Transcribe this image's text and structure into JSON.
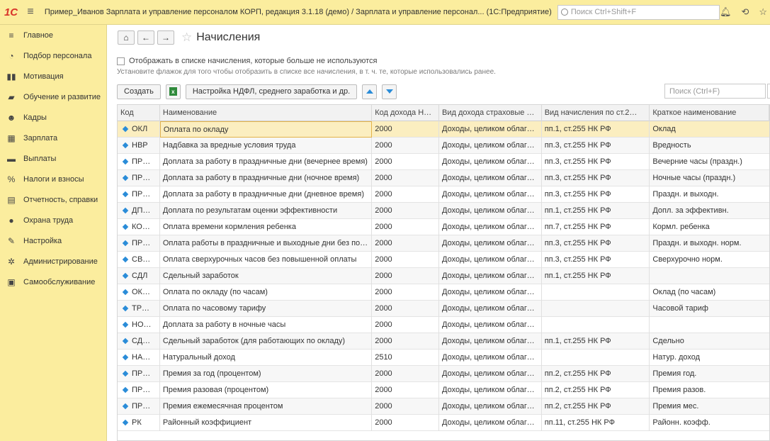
{
  "titlebar": {
    "logo": "1С",
    "title": "Пример_Иванов Зарплата и управление персоналом КОРП, редакция 3.1.18 (демо) / Зарплата и управление персонал...  (1С:Предприятие)",
    "search_placeholder": "Поиск Ctrl+Shift+F",
    "icons": [
      "bell-icon",
      "history-icon",
      "star-icon"
    ]
  },
  "sidebar": {
    "items": [
      {
        "label": "Главное",
        "icon": "≡"
      },
      {
        "label": "Подбор персонала",
        "icon": "◔"
      },
      {
        "label": "Мотивация",
        "icon": "▮▮"
      },
      {
        "label": "Обучение и развитие",
        "icon": "▰"
      },
      {
        "label": "Кадры",
        "icon": "☻"
      },
      {
        "label": "Зарплата",
        "icon": "▦"
      },
      {
        "label": "Выплаты",
        "icon": "▬"
      },
      {
        "label": "Налоги и взносы",
        "icon": "%"
      },
      {
        "label": "Отчетность, справки",
        "icon": "▤"
      },
      {
        "label": "Охрана труда",
        "icon": "●"
      },
      {
        "label": "Настройка",
        "icon": "✎"
      },
      {
        "label": "Администрирование",
        "icon": "✲"
      },
      {
        "label": "Самообслуживание",
        "icon": "▣"
      }
    ]
  },
  "page": {
    "title": "Начисления",
    "checkbox_label": "Отображать в списке начисления, которые больше не используются",
    "hint": "Установите флажок для того чтобы отобразить в списке все начисления, в т. ч. те, которые использовались ранее.",
    "create_label": "Создать",
    "settings_label": "Настройка НДФЛ, среднего заработка и др.",
    "search_placeholder": "Поиск (Ctrl+F)"
  },
  "table": {
    "headers": [
      "Код",
      "Наименование",
      "Код дохода Н…",
      "Вид дохода страховые в…",
      "Вид начисления по ст.2…",
      "Краткое наименование"
    ],
    "rows": [
      [
        "ОКЛ",
        "Оплата по окладу",
        "2000",
        "Доходы, целиком облага…",
        "пп.1, ст.255 НК РФ",
        "Оклад"
      ],
      [
        "НВР",
        "Надбавка за вредные условия труда",
        "2000",
        "Доходы, целиком облага…",
        "пп.3, ст.255 НК РФ",
        "Вредность"
      ],
      [
        "ПР…",
        "Доплата за работу в праздничные дни (вечернее время)",
        "2000",
        "Доходы, целиком облага…",
        "пп.3, ст.255 НК РФ",
        "Вечерние часы (праздн.)"
      ],
      [
        "ПР…",
        "Доплата за работу в праздничные дни (ночное время)",
        "2000",
        "Доходы, целиком облага…",
        "пп.3, ст.255 НК РФ",
        "Ночные часы (праздн.)"
      ],
      [
        "ПР…",
        "Доплата за работу в праздничные дни (дневное время)",
        "2000",
        "Доходы, целиком облага…",
        "пп.3, ст.255 НК РФ",
        "Праздн. и выходн."
      ],
      [
        "ДП…",
        "Доплата по результатам оценки эффективности",
        "2000",
        "Доходы, целиком облага…",
        "пп.1, ст.255 НК РФ",
        "Допл. за эффективн."
      ],
      [
        "КО…",
        "Оплата времени кормления ребенка",
        "2000",
        "Доходы, целиком облага…",
        "пп.7, ст.255 НК РФ",
        "Кормл. ребенка"
      ],
      [
        "ПР…",
        "Оплата работы в праздничные и выходные дни без по…",
        "2000",
        "Доходы, целиком облага…",
        "пп.3, ст.255 НК РФ",
        "Праздн. и выходн. норм."
      ],
      [
        "СВ…",
        "Оплата сверхурочных часов без повышенной оплаты",
        "2000",
        "Доходы, целиком облага…",
        "пп.3, ст.255 НК РФ",
        "Сверхурочно норм."
      ],
      [
        "СДЛ",
        "Сдельный заработок",
        "2000",
        "Доходы, целиком облага…",
        "пп.1, ст.255 НК РФ",
        ""
      ],
      [
        "ОК…",
        "Оплата по окладу (по часам)",
        "2000",
        "Доходы, целиком облага…",
        "",
        "Оклад (по часам)"
      ],
      [
        "ТР…",
        "Оплата по часовому тарифу",
        "2000",
        "Доходы, целиком облага…",
        "",
        "Часовой тариф"
      ],
      [
        "НО…",
        "Доплата за работу в ночные часы",
        "2000",
        "Доходы, целиком облага…",
        "",
        ""
      ],
      [
        "СД…",
        "Сдельный заработок (для работающих по окладу)",
        "2000",
        "Доходы, целиком облага…",
        "пп.1, ст.255 НК РФ",
        "Сдельно"
      ],
      [
        "НА…",
        "Натуральный доход",
        "2510",
        "Доходы, целиком облага…",
        "",
        "Натур. доход"
      ],
      [
        "ПР…",
        "Премия за год (процентом)",
        "2000",
        "Доходы, целиком облага…",
        "пп.2, ст.255 НК РФ",
        "Премия год."
      ],
      [
        "ПР…",
        "Премия разовая (процентом)",
        "2000",
        "Доходы, целиком облага…",
        "пп.2, ст.255 НК РФ",
        "Премия разов."
      ],
      [
        "ПР…",
        "Премия ежемесячная процентом",
        "2000",
        "Доходы, целиком облага…",
        "пп.2, ст.255 НК РФ",
        "Премия мес."
      ],
      [
        "РК",
        "Районный коэффициент",
        "2000",
        "Доходы, целиком облага…",
        "пп.11, ст.255 НК РФ",
        "Районн. коэфф."
      ]
    ]
  }
}
